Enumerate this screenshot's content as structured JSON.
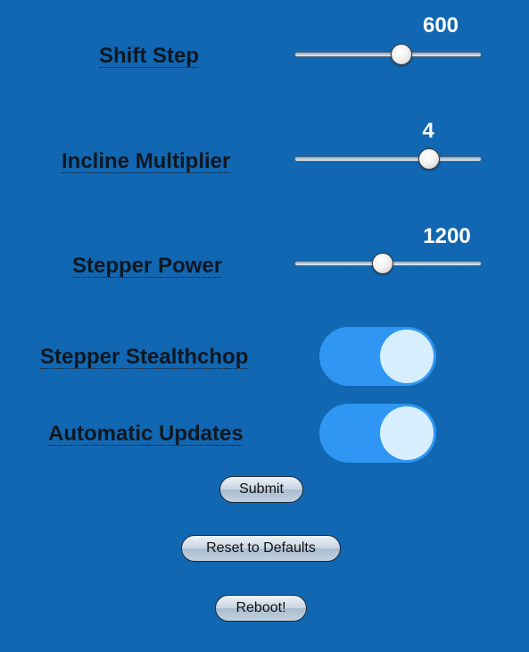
{
  "sliders": [
    {
      "label": "Shift Step",
      "value": "600",
      "fraction": 0.57
    },
    {
      "label": "Incline Multiplier",
      "value": "4",
      "fraction": 0.72
    },
    {
      "label": "Stepper Power",
      "value": "1200",
      "fraction": 0.47
    }
  ],
  "toggles": [
    {
      "label": "Stepper Stealthchop",
      "state": "on"
    },
    {
      "label": "Automatic Updates",
      "state": "on"
    }
  ],
  "buttons": {
    "submit": "Submit",
    "reset": "Reset to Defaults",
    "reboot": "Reboot!"
  },
  "colors": {
    "background": "#1167b1",
    "toggle_on": "#2f97f3",
    "toggle_knob": "#d6eefe",
    "label_text": "#0e1822",
    "value_text": "#ffffff"
  }
}
